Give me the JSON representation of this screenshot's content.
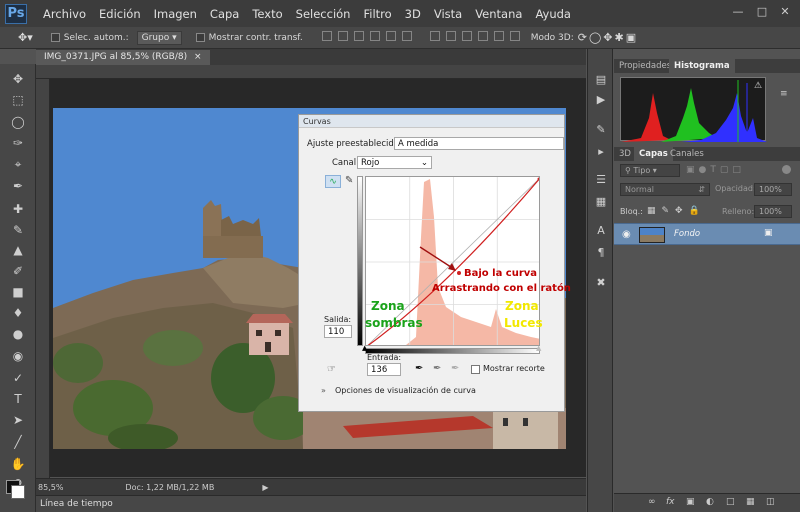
{
  "app": {
    "logo": "Ps"
  },
  "menu": [
    "Archivo",
    "Edición",
    "Imagen",
    "Capa",
    "Texto",
    "Selección",
    "Filtro",
    "3D",
    "Vista",
    "Ventana",
    "Ayuda"
  ],
  "window_controls": {
    "minimize": "—",
    "restore": "□",
    "close": "✕"
  },
  "options_bar": {
    "auto_select_label": "Selec. autom.:",
    "group_value": "Grupo",
    "show_transform_label": "Mostrar contr. transf.",
    "mode3d_label": "Modo 3D:"
  },
  "document": {
    "tab_title": "IMG_0371.JPG al 85,5% (RGB/8)",
    "zoom": "85,5%",
    "doc_info": "Doc: 1,22 MB/1,22 MB"
  },
  "timeline": {
    "label": "Línea de tiempo"
  },
  "curves_dialog": {
    "title": "Curvas",
    "preset_label": "Ajuste preestablecido:",
    "preset_value": "A medida",
    "channel_label": "Canal:",
    "channel_value": "Rojo",
    "output_label": "Salida:",
    "output_value": "110",
    "input_label": "Entrada:",
    "input_value": "136",
    "show_clipping_label": "Mostrar recorte",
    "display_options_label": "Opciones de visualización de curva"
  },
  "annotations": {
    "under_curve_1": "Bajo la curva",
    "under_curve_2": "Arrastrando  con el ratón",
    "shadows_1": "Zona",
    "shadows_2": "sombras",
    "highlights_1": "Zona",
    "highlights_2": "Luces",
    "colors": {
      "red": "#c00000",
      "green": "#1aa31a",
      "yellow": "#f2e800"
    }
  },
  "panels": {
    "top_tabs": [
      "Propiedades",
      "Histograma"
    ],
    "layer_tabs": [
      "3D",
      "Capas",
      "Canales"
    ],
    "filter_kind": "Tipo",
    "blend_mode": "Normal",
    "opacity_label": "Opacidad:",
    "opacity_value": "100%",
    "lock_label": "Bloq.:",
    "fill_label": "Relleno:",
    "fill_value": "100%",
    "layer_name": "Fondo"
  },
  "colors": {
    "accent": "#6a8cb2",
    "ui_dark": "#474747",
    "menubar": "#3c3c3c"
  }
}
